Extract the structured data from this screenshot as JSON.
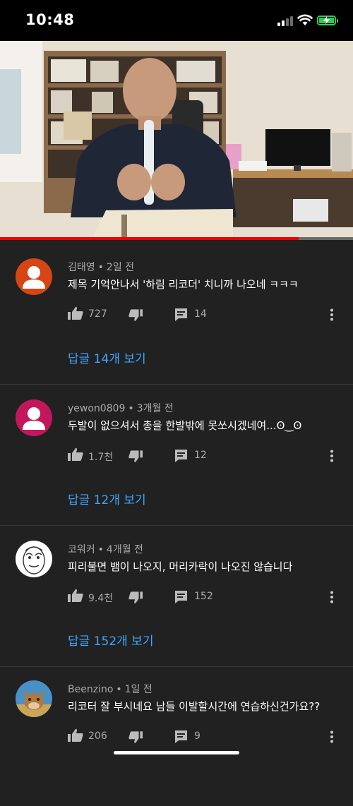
{
  "status_bar": {
    "time": "10:48"
  },
  "video": {
    "progress": 0.845
  },
  "comments": [
    {
      "author": "김태영",
      "time": "2일 전",
      "text": "제목 기억안나서 '하림 리코더' 치니까 나오네 ㅋㅋㅋ",
      "likes": "727",
      "replies": "14",
      "view_replies": "답글 14개 보기",
      "avatar_color": "#d64513"
    },
    {
      "author": "yewon0809",
      "time": "3개월 전",
      "text": "두발이 없으셔서 총을 한발밖에 못쏘시겠네여...ʘ‿ʘ",
      "likes": "1.7천",
      "replies": "12",
      "view_replies": "답글 12개 보기",
      "avatar_color": "#c2185b"
    },
    {
      "author": "코워커",
      "time": "4개월 전",
      "text": "피리불면 뱀이 나오지, 머리카락이 나오진 않습니다",
      "likes": "9.4천",
      "replies": "152",
      "view_replies": "답글 152개 보기",
      "avatar_color": "#ffffff"
    },
    {
      "author": "Beenzino",
      "time": "1일 전",
      "text": "리코터 잘 부시네요 남들 이발할시간에 연습하신건가요??",
      "likes": "206",
      "replies": "9",
      "avatar_color": "#4a90c8"
    }
  ],
  "colors": {
    "link": "#3ea6ff",
    "progress": "#ee0000",
    "background": "#212121"
  }
}
